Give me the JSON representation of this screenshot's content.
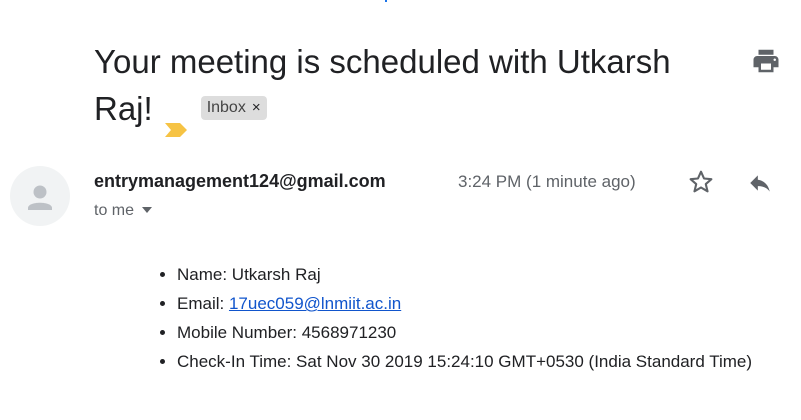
{
  "email": {
    "subject": "Your meeting is scheduled with Utkarsh Raj!",
    "label": "Inbox",
    "label_close": "×",
    "sender": "entrymanagement124@gmail.com",
    "recipient": "to me",
    "time": "3:24 PM (1 minute ago)",
    "body": {
      "name_label": "Name: ",
      "name_value": "Utkarsh Raj",
      "email_label": "Email: ",
      "email_value": "17uec059@lnmiit.ac.in",
      "mobile_label": "Mobile Number: ",
      "mobile_value": "4568971230",
      "checkin_label": "Check-In Time: ",
      "checkin_value": "Sat Nov 30 2019 15:24:10 GMT+0530 (India Standard Time)"
    }
  },
  "icons": {
    "important": "important-marker-icon",
    "print": "print-icon",
    "avatar": "person-icon",
    "star": "star-icon",
    "reply": "reply-icon",
    "dropdown": "chevron-down-icon"
  },
  "colors": {
    "important": "#f6c344",
    "link": "#1155cc",
    "chip_bg": "#dddddd",
    "icon_gray": "#5f6368"
  }
}
